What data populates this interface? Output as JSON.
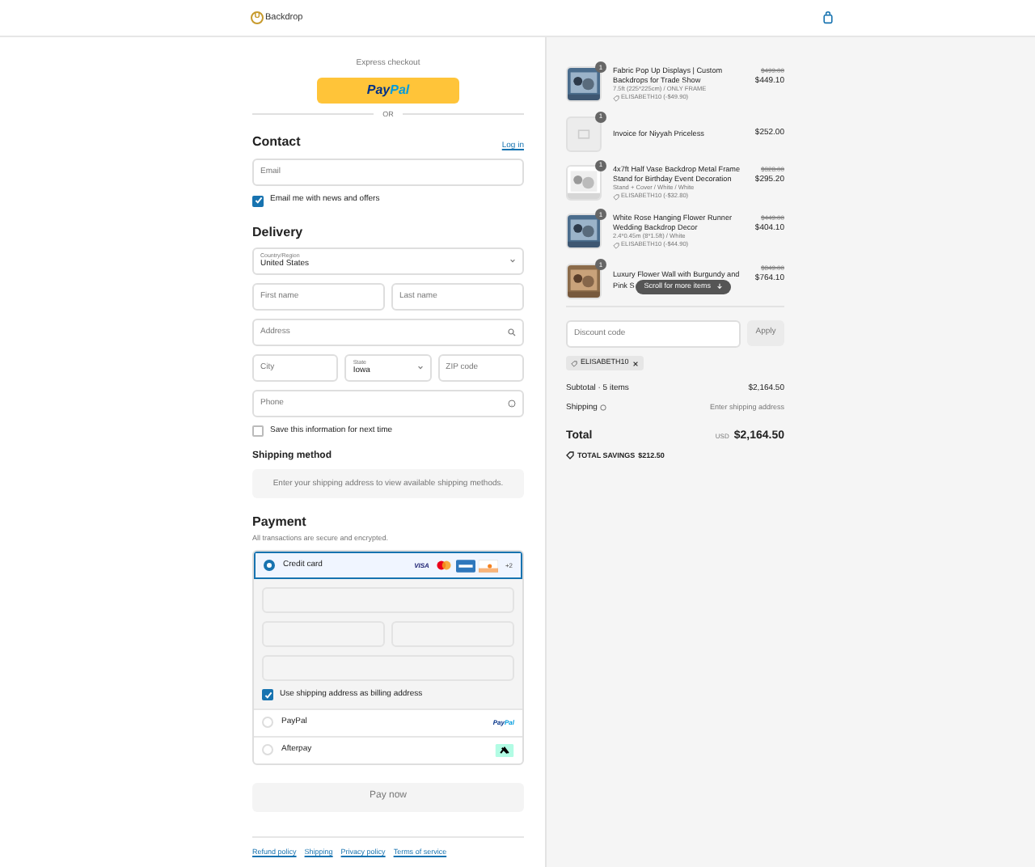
{
  "header": {
    "logo_mark": "U",
    "logo_text": "Backdrop"
  },
  "express": {
    "label": "Express checkout",
    "paypal_first": "Pay",
    "paypal_second": "Pal",
    "divider": "OR"
  },
  "contact": {
    "title": "Contact",
    "login": "Log in",
    "email_placeholder": "Email",
    "newsletter": {
      "label": "Email me with news and offers",
      "checked": true
    }
  },
  "delivery": {
    "title": "Delivery",
    "country_label": "Country/Region",
    "country": "United States",
    "first_name": "First name",
    "last_name": "Last name",
    "address": "Address",
    "city": "City",
    "state_label": "State",
    "state": "Iowa",
    "zip": "ZIP code",
    "phone": "Phone",
    "save": {
      "label": "Save this information for next time",
      "checked": false
    }
  },
  "shipping": {
    "title": "Shipping method",
    "message": "Enter your shipping address to view available shipping methods."
  },
  "payment": {
    "title": "Payment",
    "subtitle": "All transactions are secure and encrypted.",
    "methods": [
      {
        "kind": "card",
        "label": "Credit card",
        "selected": true,
        "brands": [
          {
            "kind": "visa",
            "label": "VISA"
          },
          {
            "kind": "mastercard"
          },
          {
            "kind": "amex"
          },
          {
            "kind": "discover"
          }
        ],
        "more": "+2"
      },
      {
        "kind": "paypal",
        "label": "PayPal",
        "selected": false,
        "logo_first": "Pay",
        "logo_second": "Pal"
      },
      {
        "kind": "afterpay",
        "label": "Afterpay",
        "selected": false
      }
    ],
    "billing": {
      "label": "Use shipping address as billing address",
      "checked": true
    },
    "pay_button": "Pay now"
  },
  "footer_links": [
    "Refund policy",
    "Shipping",
    "Privacy policy",
    "Terms of service"
  ],
  "order": {
    "items": [
      {
        "kind": "picture",
        "qty": "1",
        "name": "Fabric Pop Up Displays | Custom Backdrops for Trade Show",
        "variant": "7.5ft (225*225cm) / ONLY FRAME",
        "discount": "ELISABETH10 (-$49.90)",
        "old_price": "$499.00",
        "price": "$449.10"
      },
      {
        "kind": "placeholder",
        "qty": "1",
        "name": "Invoice for Niyyah Priceless",
        "price": "$252.00"
      },
      {
        "kind": "stand",
        "qty": "1",
        "name": "4x7ft Half Vase Backdrop Metal Frame Stand for Birthday Event Decoration",
        "variant": "Stand + Cover / White / White",
        "discount": "ELISABETH10 (-$32.80)",
        "old_price": "$328.00",
        "price": "$295.20"
      },
      {
        "kind": "picture",
        "qty": "1",
        "name": "White Rose Hanging Flower Runner Wedding Backdrop Decor",
        "variant": "2.4*0.45m (8*1.5ft) / White",
        "discount": "ELISABETH10 (-$44.90)",
        "old_price": "$449.00",
        "price": "$404.10"
      },
      {
        "kind": "flowers",
        "qty": "1",
        "name": "Luxury Flower Wall with Burgundy and",
        "name_tail": "Pink S",
        "old_price": "$849.00",
        "price": "$764.10"
      }
    ],
    "scroll_hint": "Scroll for more items",
    "discount_placeholder": "Discount code",
    "apply": "Apply",
    "applied_code": "ELISABETH10",
    "subtotal_label": "Subtotal · 5 items",
    "subtotal": "$2,164.50",
    "shipping_label": "Shipping",
    "shipping_value": "Enter shipping address",
    "total_label": "Total",
    "currency": "USD",
    "total": "$2,164.50",
    "savings_label": "TOTAL SAVINGS",
    "savings": "$212.50"
  }
}
